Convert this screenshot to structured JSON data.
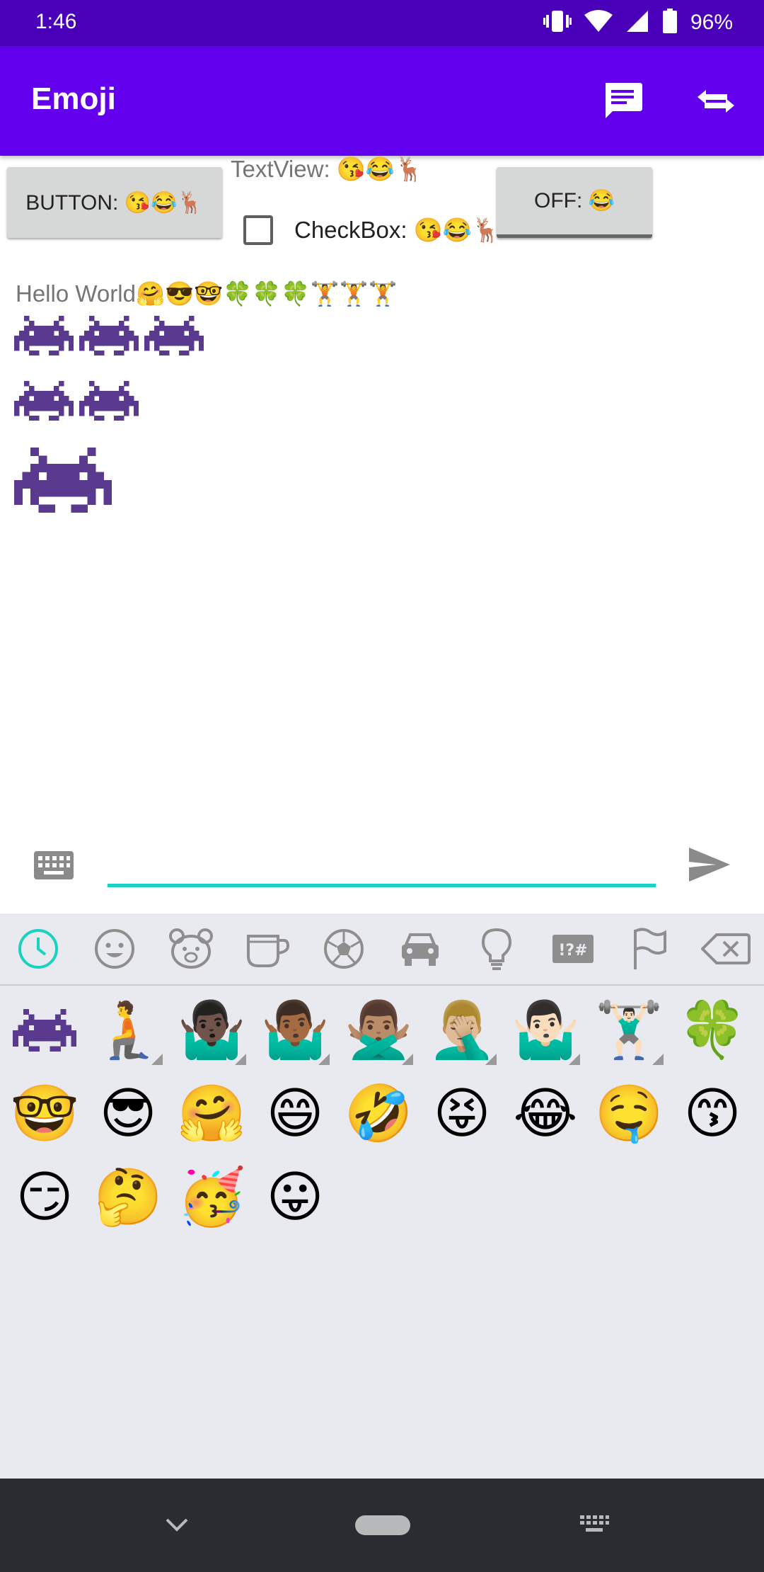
{
  "status_bar": {
    "time": "1:46",
    "battery": "96%"
  },
  "app_bar": {
    "title": "Emoji",
    "icons": [
      "message-icon",
      "swap-icon"
    ]
  },
  "controls": {
    "button_label": "BUTTON: 😘😂🦌",
    "textview_label": "TextView: 😘😂🦌",
    "checkbox_label": "CheckBox: 😘😂🦌",
    "checkbox_checked": false,
    "toggle_label": "OFF: 😂"
  },
  "hello_text": "Hello World🤗😎🤓🍀🍀🍀🏋️🏋️🏋️",
  "invaders": {
    "row1_count": 3,
    "row2_count": 2,
    "row3_count": 1
  },
  "input": {
    "value": "",
    "accent_color": "#1ad2c0"
  },
  "emoji_tabs": [
    "recent-clock-icon",
    "smiley-icon",
    "bear-icon",
    "cup-icon",
    "ball-icon",
    "car-icon",
    "bulb-icon",
    "symbols-icon",
    "flag-icon",
    "backspace-icon"
  ],
  "recent_emojis": [
    {
      "char": "👾",
      "variants": false
    },
    {
      "char": "🧎",
      "variants": true
    },
    {
      "char": "🤷🏿‍♂️",
      "variants": true
    },
    {
      "char": "🤷🏾‍♂️",
      "variants": true
    },
    {
      "char": "🙅🏽‍♂️",
      "variants": true
    },
    {
      "char": "🤦🏼‍♂️",
      "variants": true
    },
    {
      "char": "🤷🏻‍♂️",
      "variants": true
    },
    {
      "char": "🏋🏻‍♂️",
      "variants": true
    },
    {
      "char": "🍀",
      "variants": false
    },
    {
      "char": "🤓",
      "variants": false
    },
    {
      "char": "😎",
      "variants": false
    },
    {
      "char": "🤗",
      "variants": false
    },
    {
      "char": "😄",
      "variants": false
    },
    {
      "char": "🤣",
      "variants": false
    },
    {
      "char": "😝",
      "variants": false
    },
    {
      "char": "😂",
      "variants": false
    },
    {
      "char": "🤤",
      "variants": false
    },
    {
      "char": "😙",
      "variants": false
    },
    {
      "char": "😏",
      "variants": false
    },
    {
      "char": "🤔",
      "variants": false
    },
    {
      "char": "🥳",
      "variants": false
    },
    {
      "char": "😛",
      "variants": false
    }
  ],
  "colors": {
    "status_bar": "#4a00b8",
    "app_bar": "#6200ee",
    "invader": "#5a3a8e",
    "nav_bar": "#2a2c31"
  }
}
